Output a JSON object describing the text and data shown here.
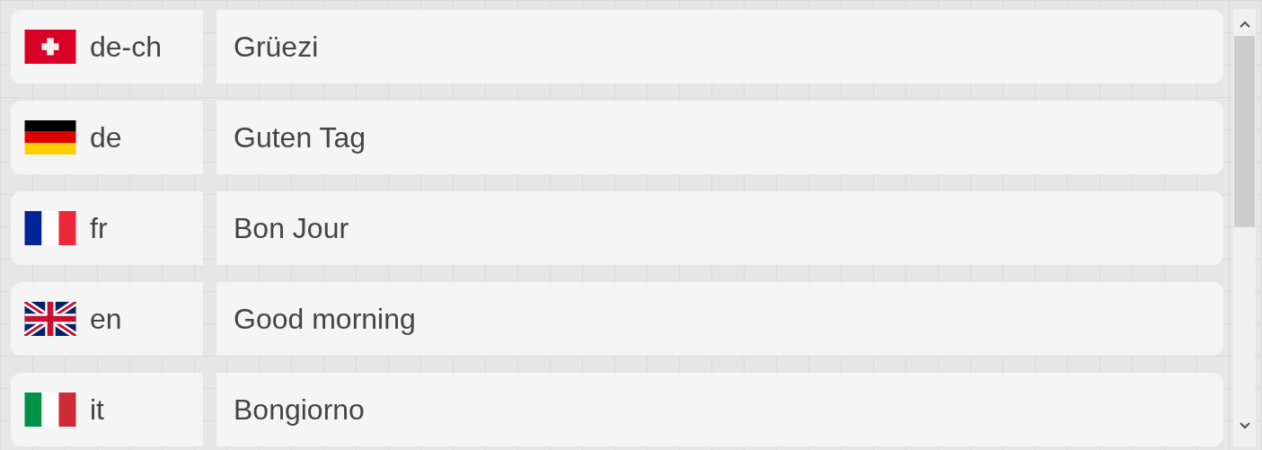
{
  "rows": [
    {
      "kind": "ch",
      "code": "de-ch",
      "greeting": "Grüezi"
    },
    {
      "kind": "de",
      "code": "de",
      "greeting": "Guten Tag"
    },
    {
      "kind": "fr",
      "code": "fr",
      "greeting": "Bon Jour"
    },
    {
      "kind": "gb",
      "code": "en",
      "greeting": "Good morning"
    },
    {
      "kind": "it",
      "code": "it",
      "greeting": "Bongiorno"
    }
  ]
}
